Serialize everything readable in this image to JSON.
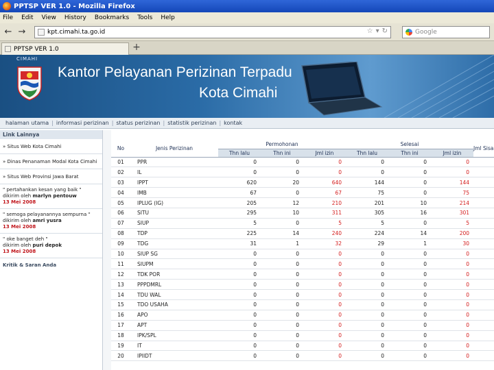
{
  "browser": {
    "window_title": "PPTSP VER 1.0 - Mozilla Firefox",
    "menu": [
      "File",
      "Edit",
      "View",
      "History",
      "Bookmarks",
      "Tools",
      "Help"
    ],
    "url": "kpt.cimahi.ta.go.id",
    "search_placeholder": "Google",
    "tab_title": "PPTSP VER 1.0",
    "new_tab": "+"
  },
  "header": {
    "logo_caption": "CIMAHI",
    "title_line1": "Kantor Pelayanan Perizinan Terpadu",
    "title_line2": "Kota Cimahi"
  },
  "nav": [
    "halaman utama",
    "informasi perizinan",
    "status perizinan",
    "statistik perizinan",
    "kontak"
  ],
  "sidebar": {
    "heading": "Link Lainnya",
    "links": [
      "» Situs Web Kota Cimahi",
      "» Dinas Penanaman Modal Kota Cimahi",
      "» Situs Web Provinsi Jawa Barat"
    ],
    "testimonials": [
      {
        "quote": "\" pertahankan kesan yang baik \"",
        "by_label": "dikirim oleh",
        "author": "marlyn pentouw",
        "date": "13 Mei 2008"
      },
      {
        "quote": "\" semoga pelayanannya sempurna \"",
        "by_label": "dikirim oleh",
        "author": "amri yusra",
        "date": "13 Mei 2008"
      },
      {
        "quote": "\" oke banget deh \"",
        "by_label": "dikirim oleh",
        "author": "puri depok",
        "date": "13 Mei 2008"
      }
    ],
    "kritik": "Kritik & Saran Anda"
  },
  "table": {
    "headers": {
      "no": "No",
      "jenis": "Jenis Perizinan",
      "permohonan": "Permohonan",
      "selesai": "Selesai",
      "jml_sisa": "Jml Sisa",
      "thn_lalu": "Thn lalu",
      "thn_ini": "Thn ini",
      "jml_izin": "Jml izin"
    },
    "rows": [
      {
        "no": "01",
        "jenis": "PPR",
        "v": [
          "0",
          "0",
          "0",
          "0",
          "0",
          "0"
        ]
      },
      {
        "no": "02",
        "jenis": "IL",
        "v": [
          "0",
          "0",
          "0",
          "0",
          "0",
          "0"
        ]
      },
      {
        "no": "03",
        "jenis": "IPPT",
        "v": [
          "620",
          "20",
          "640",
          "144",
          "0",
          "144"
        ]
      },
      {
        "no": "04",
        "jenis": "IMB",
        "v": [
          "67",
          "0",
          "67",
          "75",
          "0",
          "75"
        ]
      },
      {
        "no": "05",
        "jenis": "IPLUG (IG)",
        "v": [
          "205",
          "12",
          "210",
          "201",
          "10",
          "214"
        ]
      },
      {
        "no": "06",
        "jenis": "SITU",
        "v": [
          "295",
          "10",
          "311",
          "305",
          "16",
          "301"
        ]
      },
      {
        "no": "07",
        "jenis": "SIUP",
        "v": [
          "5",
          "0",
          "5",
          "5",
          "0",
          "5"
        ]
      },
      {
        "no": "08",
        "jenis": "TDP",
        "v": [
          "225",
          "14",
          "240",
          "224",
          "14",
          "200"
        ]
      },
      {
        "no": "09",
        "jenis": "TDG",
        "v": [
          "31",
          "1",
          "32",
          "29",
          "1",
          "30"
        ]
      },
      {
        "no": "10",
        "jenis": "SIUP SG",
        "v": [
          "0",
          "0",
          "0",
          "0",
          "0",
          "0"
        ]
      },
      {
        "no": "11",
        "jenis": "SIUPM",
        "v": [
          "0",
          "0",
          "0",
          "0",
          "0",
          "0"
        ]
      },
      {
        "no": "12",
        "jenis": "TDK POR",
        "v": [
          "0",
          "0",
          "0",
          "0",
          "0",
          "0"
        ]
      },
      {
        "no": "13",
        "jenis": "PPPDMRL",
        "v": [
          "0",
          "0",
          "0",
          "0",
          "0",
          "0"
        ]
      },
      {
        "no": "14",
        "jenis": "TDU WAL",
        "v": [
          "0",
          "0",
          "0",
          "0",
          "0",
          "0"
        ]
      },
      {
        "no": "15",
        "jenis": "TDO USAHA",
        "v": [
          "0",
          "0",
          "0",
          "0",
          "0",
          "0"
        ]
      },
      {
        "no": "16",
        "jenis": "APO",
        "v": [
          "0",
          "0",
          "0",
          "0",
          "0",
          "0"
        ]
      },
      {
        "no": "17",
        "jenis": "APT",
        "v": [
          "0",
          "0",
          "0",
          "0",
          "0",
          "0"
        ]
      },
      {
        "no": "18",
        "jenis": "IPK/SPL",
        "v": [
          "0",
          "0",
          "0",
          "0",
          "0",
          "0"
        ]
      },
      {
        "no": "19",
        "jenis": "IT",
        "v": [
          "0",
          "0",
          "0",
          "0",
          "0",
          "0"
        ]
      },
      {
        "no": "20",
        "jenis": "IPIIDT",
        "v": [
          "0",
          "0",
          "0",
          "0",
          "0",
          "0"
        ]
      }
    ]
  }
}
